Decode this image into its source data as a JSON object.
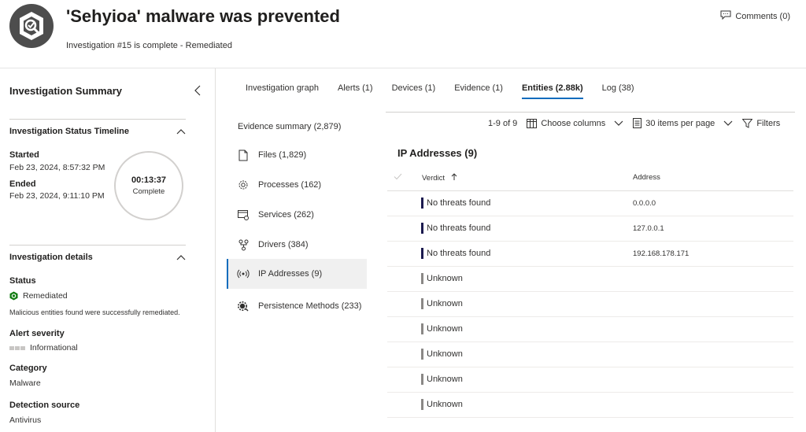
{
  "header": {
    "title": "'Sehyioa' malware was prevented",
    "subtitle": "Investigation #15 is complete - Remediated",
    "comments_label": "Comments (0)"
  },
  "summary": {
    "title": "Investigation Summary",
    "timeline": {
      "heading": "Investigation Status Timeline",
      "started_label": "Started",
      "started_value": "Feb 23, 2024, 8:57:32 PM",
      "ended_label": "Ended",
      "ended_value": "Feb 23, 2024, 9:11:10 PM",
      "duration": "00:13:37",
      "duration_status": "Complete"
    },
    "details": {
      "heading": "Investigation details",
      "status_label": "Status",
      "status_value": "Remediated",
      "status_note": "Malicious entities found were successfully remediated.",
      "severity_label": "Alert severity",
      "severity_value": "Informational",
      "category_label": "Category",
      "category_value": "Malware",
      "source_label": "Detection source",
      "source_value": "Antivirus"
    }
  },
  "tabs": [
    {
      "label": "Investigation graph"
    },
    {
      "label": "Alerts  (1)"
    },
    {
      "label": "Devices  (1)"
    },
    {
      "label": "Evidence  (1)"
    },
    {
      "label": "Entities  (2.88k)",
      "active": true
    },
    {
      "label": "Log  (38)"
    }
  ],
  "evidence": {
    "summary": "Evidence summary (2,879)",
    "items": [
      {
        "label": "Files (1,829)",
        "icon": "file-icon"
      },
      {
        "label": "Processes (162)",
        "icon": "gear-icon"
      },
      {
        "label": "Services (262)",
        "icon": "services-icon"
      },
      {
        "label": "Drivers (384)",
        "icon": "driver-icon"
      },
      {
        "label": "IP Addresses (9)",
        "icon": "broadcast-icon",
        "active": true
      },
      {
        "label": "Persistence Methods (233)",
        "icon": "persistence-icon"
      }
    ]
  },
  "toolbar": {
    "paging": "1-9 of 9",
    "choose_columns": "Choose columns",
    "items_per_page": "30 items per page",
    "filters": "Filters"
  },
  "table": {
    "title": "IP Addresses (9)",
    "columns": {
      "verdict": "Verdict",
      "address": "Address"
    },
    "rows": [
      {
        "verdict": "No threats found",
        "address": "0.0.0.0",
        "color": "#1b1a4f"
      },
      {
        "verdict": "No threats found",
        "address": "127.0.0.1",
        "color": "#1b1a4f"
      },
      {
        "verdict": "No threats found",
        "address": "192.168.178.171",
        "color": "#1b1a4f"
      },
      {
        "verdict": "Unknown",
        "address": "",
        "color": "#8a8886"
      },
      {
        "verdict": "Unknown",
        "address": "",
        "color": "#8a8886"
      },
      {
        "verdict": "Unknown",
        "address": "",
        "color": "#8a8886"
      },
      {
        "verdict": "Unknown",
        "address": "",
        "color": "#8a8886"
      },
      {
        "verdict": "Unknown",
        "address": "",
        "color": "#8a8886"
      },
      {
        "verdict": "Unknown",
        "address": "",
        "color": "#8a8886"
      }
    ]
  },
  "colors": {
    "accent": "#0f6cbd",
    "remediated": "#107c10"
  }
}
